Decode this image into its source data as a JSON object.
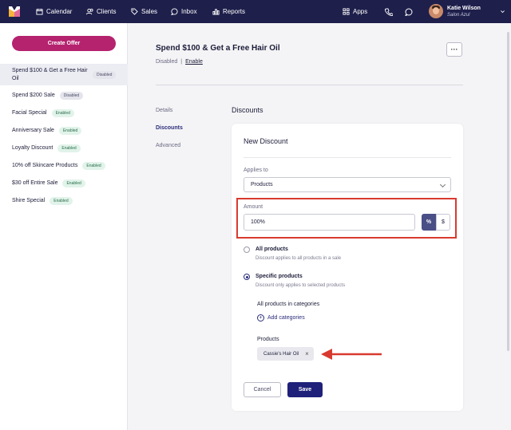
{
  "nav": {
    "items": [
      {
        "label": "Calendar",
        "icon": "calendar-icon"
      },
      {
        "label": "Clients",
        "icon": "clients-icon"
      },
      {
        "label": "Sales",
        "icon": "tag-icon"
      },
      {
        "label": "Inbox",
        "icon": "inbox-icon"
      },
      {
        "label": "Reports",
        "icon": "reports-icon"
      }
    ],
    "apps_label": "Apps",
    "user": {
      "name": "Katie Wilson",
      "salon": "Salon Azul"
    }
  },
  "sidebar": {
    "create_label": "Create Offer",
    "offers": [
      {
        "label": "Spend $100 & Get a Free Hair Oil",
        "status": "Disabled"
      },
      {
        "label": "Spend $200 Sale",
        "status": "Disabled"
      },
      {
        "label": "Facial Special",
        "status": "Enabled"
      },
      {
        "label": "Anniversary Sale",
        "status": "Enabled"
      },
      {
        "label": "Loyalty Discount",
        "status": "Enabled"
      },
      {
        "label": "10% off Skincare Products",
        "status": "Enabled"
      },
      {
        "label": "$30 off Entire Sale",
        "status": "Enabled"
      },
      {
        "label": "Shire Special",
        "status": "Enabled"
      }
    ]
  },
  "main": {
    "title": "Spend $100 & Get a Free Hair Oil",
    "status": "Disabled",
    "separator": "|",
    "enable_link": "Enable",
    "more_label": "···",
    "subnav": [
      "Details",
      "Discounts",
      "Advanced"
    ],
    "section_title": "Discounts"
  },
  "discount": {
    "title": "New Discount",
    "applies_label": "Applies to",
    "applies_value": "Products",
    "amount_label": "Amount",
    "amount_value": "100%",
    "pct_label": "%",
    "usd_label": "$",
    "all_title": "All products",
    "all_desc": "Discount applies to all products in a sale",
    "specific_title": "Specific products",
    "specific_desc": "Discount only applies to selected products",
    "categories_label": "All products in categories",
    "add_categories": "Add categories",
    "products_label": "Products",
    "product_chip": "Cassie's Hair Oil",
    "chip_remove": "×",
    "cancel_label": "Cancel",
    "save_label": "Save"
  },
  "colors": {
    "nav": "#1e1f4b",
    "primary": "#b5226e",
    "accent": "#1f207a",
    "highlight": "#d93a2f"
  }
}
